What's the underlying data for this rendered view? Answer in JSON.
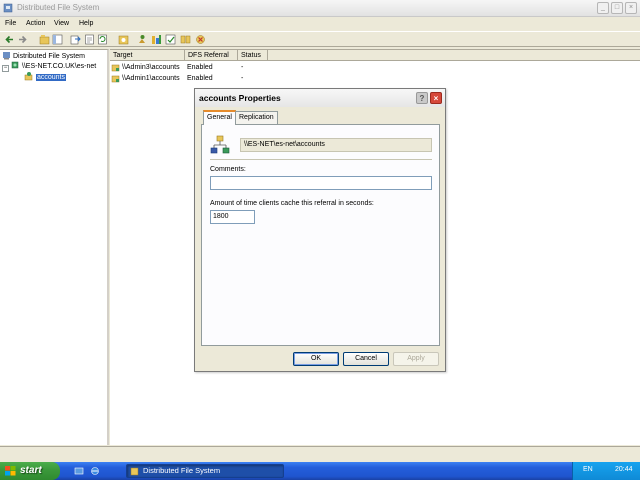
{
  "window": {
    "title": "Distributed File System",
    "controls": {
      "minimize": "_",
      "maximize": "□",
      "close": "×"
    }
  },
  "menu": [
    "File",
    "Action",
    "View",
    "Help"
  ],
  "toolbar": {
    "icons": [
      "back-arrow-icon",
      "forward-arrow-icon",
      "up-folder-icon",
      "show-tree-icon",
      "export-icon",
      "properties-icon",
      "refresh-icon",
      "help-icon",
      "new-root-icon",
      "new-link-icon",
      "status-icon",
      "replication-icon",
      "delete-icon"
    ]
  },
  "tree": {
    "root": "Distributed File System",
    "server": "\\\\ES-NET.CO.UK\\es-net",
    "link": "accounts"
  },
  "list": {
    "columns": [
      "Target",
      "DFS Referral",
      "Status"
    ],
    "rows": [
      {
        "target": "\\\\Admin3\\accounts",
        "referral": "Enabled",
        "status": "-"
      },
      {
        "target": "\\\\Admin1\\accounts",
        "referral": "Enabled",
        "status": "-"
      }
    ]
  },
  "dialog": {
    "title": "accounts Properties",
    "help": "?",
    "close": "×",
    "tabs": [
      "General",
      "Replication"
    ],
    "path": "\\\\ES-NET\\es-net\\accounts",
    "comments_label": "Comments:",
    "comments_value": "",
    "cache_label": "Amount of time clients cache this referral in seconds:",
    "cache_value": "1800",
    "ok": "OK",
    "cancel": "Cancel",
    "apply": "Apply"
  },
  "taskbar": {
    "start": "start",
    "task": "Distributed File System",
    "language": "EN",
    "clock": "20:44"
  },
  "colors": {
    "selection": "#316ac5",
    "taskbar": "#245edb",
    "start_green": "#3c9a3c",
    "tab_accent": "#e68b2c"
  }
}
